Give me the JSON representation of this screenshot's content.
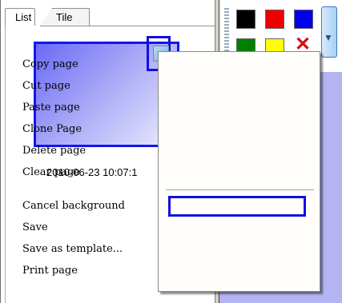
{
  "tabs": [
    {
      "label": "List"
    },
    {
      "label": "Tile"
    }
  ],
  "thumbnail": {
    "date": "2010-06-23 10:07:1"
  },
  "palette": {
    "colors": [
      "#000000",
      "#ee0000",
      "#0000ee",
      "#008000",
      "#ffff00"
    ],
    "delete_icon": "x-icon"
  },
  "context_menu": {
    "items": [
      {
        "label": "Copy page"
      },
      {
        "label": "Cut page"
      },
      {
        "label": "Paste page"
      },
      {
        "label": "Clone Page"
      },
      {
        "label": "Delete page"
      },
      {
        "label": "Clear page"
      },
      {
        "label": "Cancel background"
      },
      {
        "label": "Save"
      },
      {
        "label": "Save as template..."
      },
      {
        "label": "Print page"
      }
    ]
  }
}
